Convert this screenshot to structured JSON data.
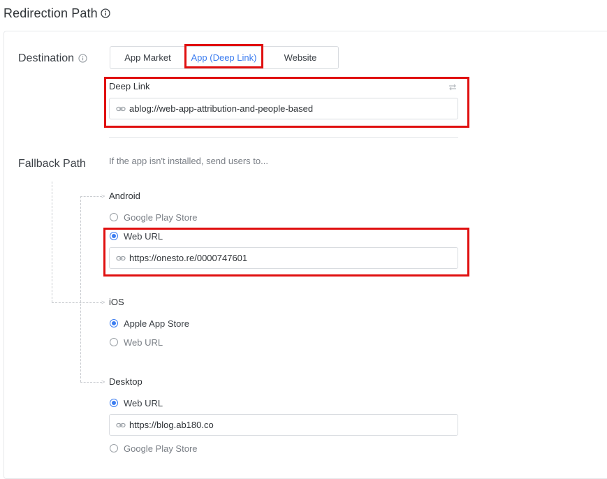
{
  "header": {
    "title": "Redirection Path",
    "info_icon": "info-circle-icon"
  },
  "destination": {
    "label": "Destination",
    "tabs": [
      {
        "label": "App Market",
        "active": false
      },
      {
        "label": "App (Deep Link)",
        "active": true
      },
      {
        "label": "Website",
        "active": false
      }
    ],
    "deep_link": {
      "label": "Deep Link",
      "swap_icon": "swap-arrows-icon",
      "value": "ablog://web-app-attribution-and-people-based"
    }
  },
  "fallback": {
    "label": "Fallback Path",
    "hint": "If the app isn't installed, send users to...",
    "android": {
      "label": "Android",
      "options": [
        {
          "label": "Google Play Store",
          "checked": false
        },
        {
          "label": "Web URL",
          "checked": true
        }
      ],
      "url": "https://onesto.re/0000747601"
    },
    "ios": {
      "label": "iOS",
      "options": [
        {
          "label": "Apple App Store",
          "checked": true
        },
        {
          "label": "Web URL",
          "checked": false
        }
      ]
    },
    "desktop": {
      "label": "Desktop",
      "options": [
        {
          "label": "Web URL",
          "checked": true
        },
        {
          "label": "Google Play Store",
          "checked": false
        }
      ],
      "url": "https://blog.ab180.co"
    }
  },
  "colors": {
    "accent": "#3c7df0",
    "highlight": "#e01010",
    "border": "#d9dce0"
  }
}
